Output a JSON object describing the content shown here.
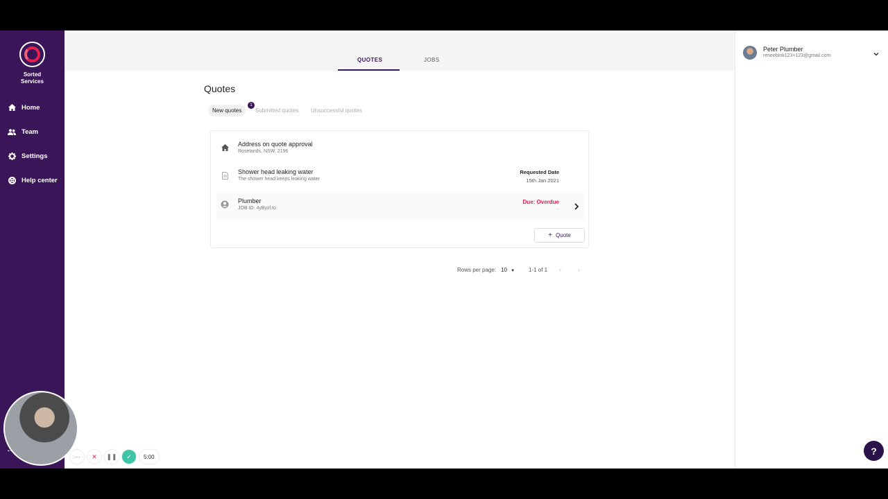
{
  "brand": {
    "name_line1": "Sorted",
    "name_line2": "Services"
  },
  "sidebar": {
    "items": [
      {
        "label": "Home",
        "icon": "home-icon"
      },
      {
        "label": "Team",
        "icon": "team-icon"
      },
      {
        "label": "Settings",
        "icon": "gear-icon"
      },
      {
        "label": "Help center",
        "icon": "lifebuoy-icon"
      }
    ]
  },
  "header": {
    "tabs": [
      {
        "label": "QUOTES",
        "active": true
      },
      {
        "label": "JOBS",
        "active": false
      }
    ]
  },
  "page": {
    "title": "Quotes",
    "subtabs": [
      {
        "label": "New quotes",
        "active": true,
        "badge": "1"
      },
      {
        "label": "Submitted quotes",
        "active": false
      },
      {
        "label": "Unsuccessful quotes",
        "active": false
      }
    ]
  },
  "quote_card": {
    "address_title": "Address on quote approval",
    "address_sub": "Roselands, NSW, 2196",
    "job_title": "Shower head leaking water",
    "job_sub": "The shower head keeps leaking water",
    "requested_label": "Requested Date",
    "requested_date": "15th Jan 2021",
    "trade_title": "Plumber",
    "trade_sub": "JOB ID: 4yByzl.to",
    "due_label": "Due: Overdue",
    "due_sub": "--",
    "quote_button": "Quote"
  },
  "pagination": {
    "rows_label": "Rows per page:",
    "rows_value": "10",
    "range": "1-1 of 1"
  },
  "user": {
    "name": "Peter Plumber",
    "email": "reneebink123+123@gmail.com"
  },
  "help_button": "?",
  "recorder": {
    "timer": "5:00"
  },
  "colors": {
    "sidebar": "#3a1659",
    "accent": "#e0224f",
    "recorder_ok": "#3cc6a6"
  }
}
